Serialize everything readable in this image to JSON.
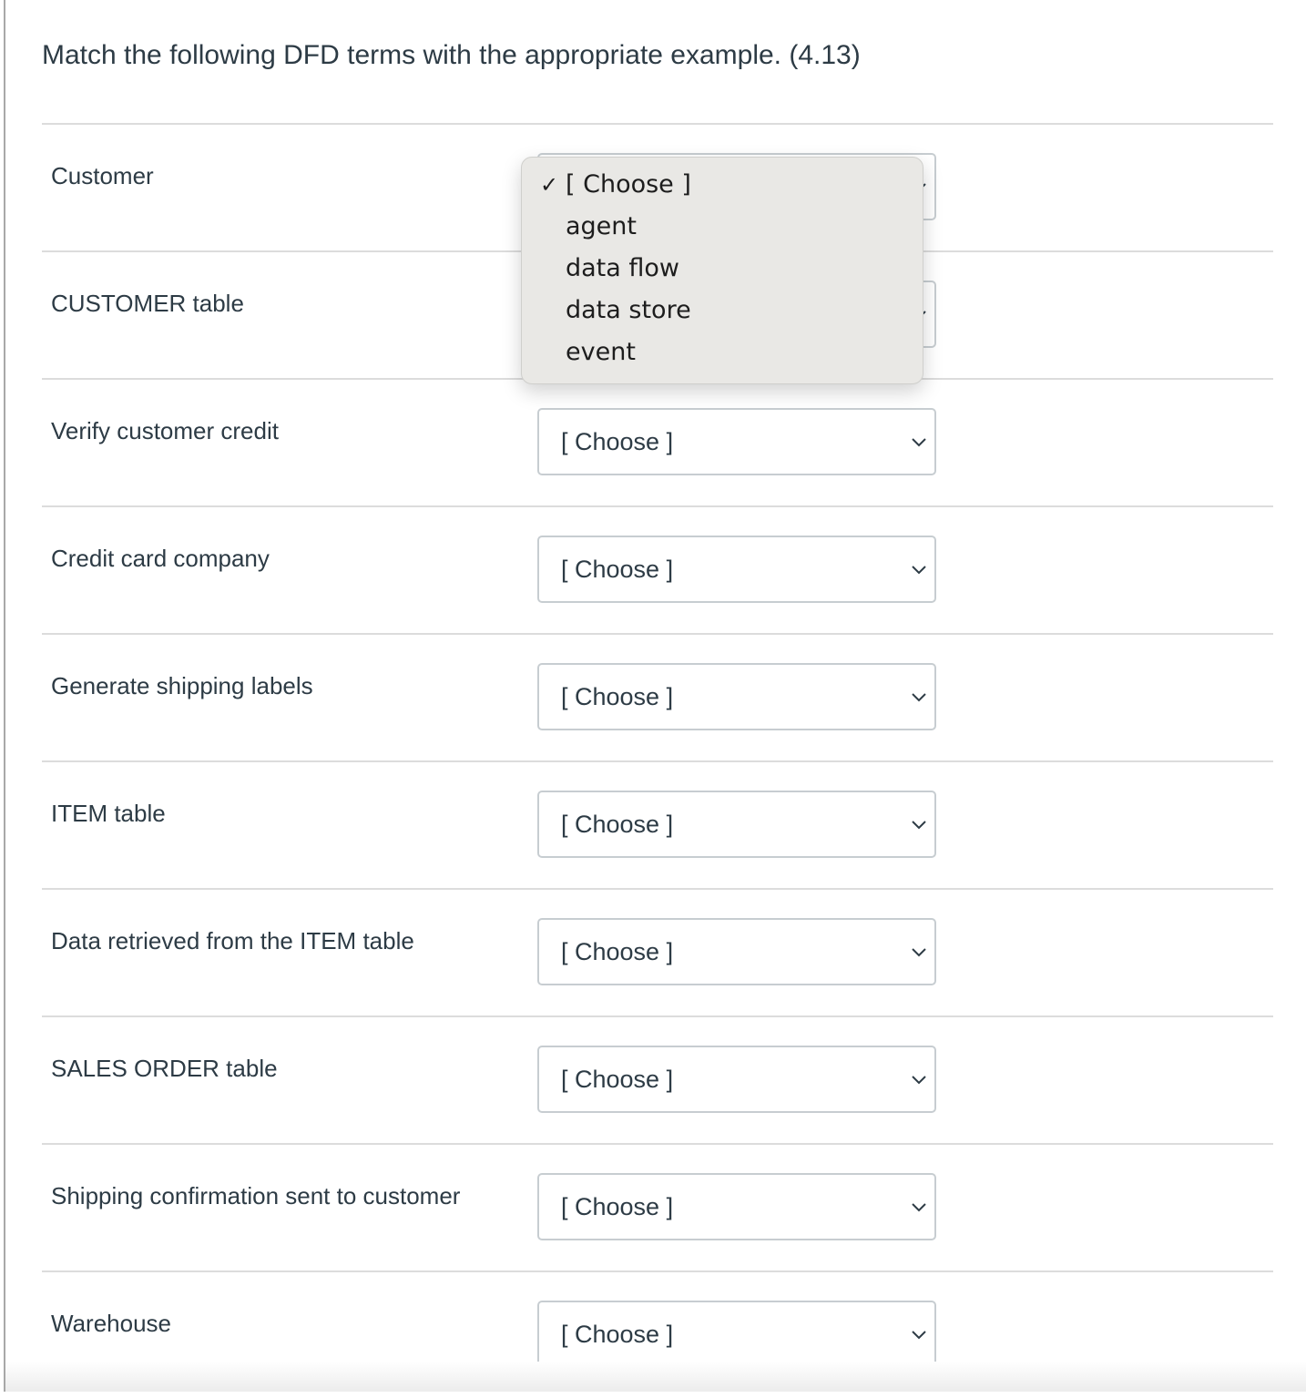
{
  "question": {
    "text": "Match the following DFD terms with the appropriate example. (4.13)"
  },
  "rows": [
    {
      "label": "Customer",
      "selected": "[ Choose ]"
    },
    {
      "label": "CUSTOMER table",
      "selected": "[ Choose ]"
    },
    {
      "label": "Verify customer credit",
      "selected": "[ Choose ]"
    },
    {
      "label": "Credit card company",
      "selected": "[ Choose ]"
    },
    {
      "label": "Generate shipping labels",
      "selected": "[ Choose ]"
    },
    {
      "label": "ITEM table",
      "selected": "[ Choose ]"
    },
    {
      "label": "Data retrieved from the ITEM table",
      "selected": "[ Choose ]"
    },
    {
      "label": "SALES ORDER table",
      "selected": "[ Choose ]"
    },
    {
      "label": "Shipping confirmation sent to customer",
      "selected": "[ Choose ]"
    },
    {
      "label": "Warehouse",
      "selected": "[ Choose ]"
    }
  ],
  "dropdown": {
    "open_for_row": "Customer",
    "check_glyph": "✓",
    "options": [
      {
        "label": "[ Choose ]",
        "checked": true
      },
      {
        "label": "agent",
        "checked": false
      },
      {
        "label": "data flow",
        "checked": false
      },
      {
        "label": "data store",
        "checked": false
      },
      {
        "label": "event",
        "checked": false
      }
    ]
  }
}
